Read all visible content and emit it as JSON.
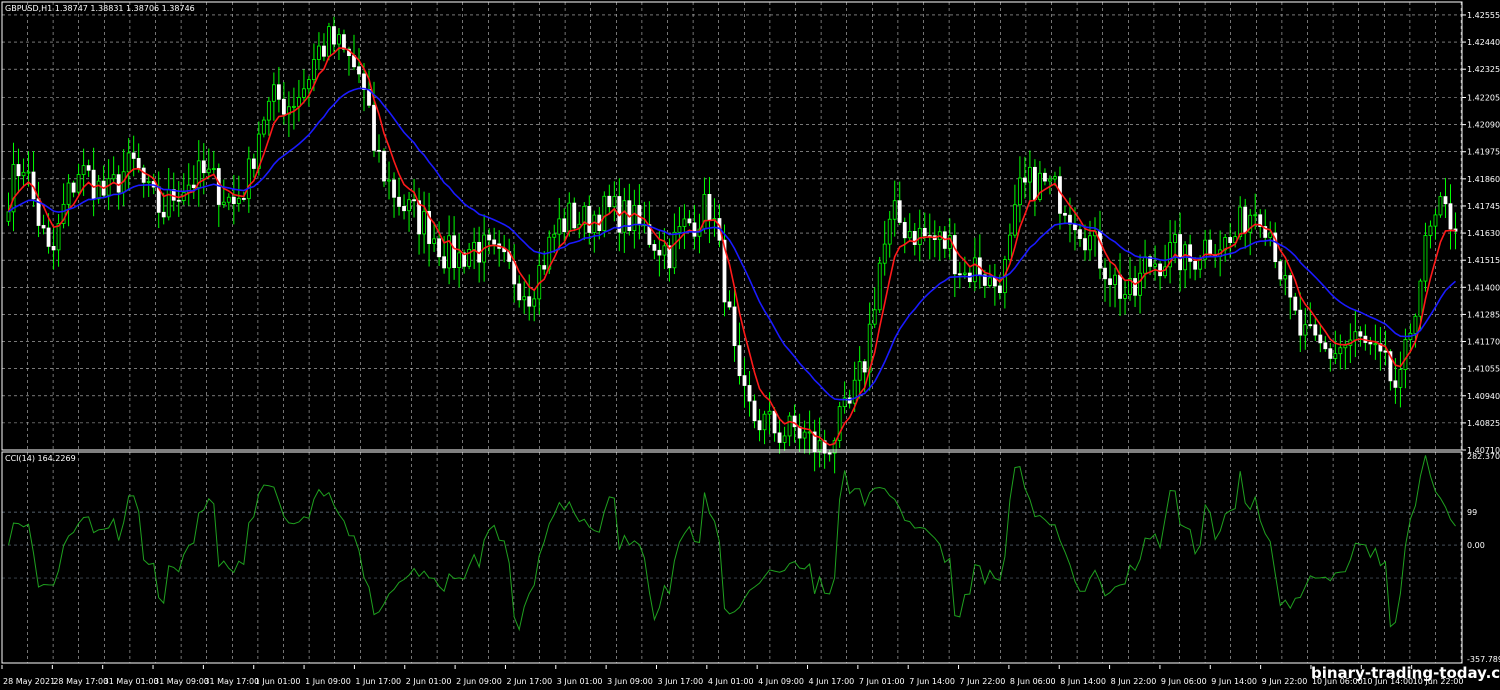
{
  "chart_data": {
    "type": "candlestick",
    "symbol_header": "GBPUSD,H1  1.38747 1.38831 1.38706 1.38746",
    "price_axis_ticks": [
      "1.42555",
      "1.42440",
      "1.42325",
      "1.42205",
      "1.42090",
      "1.41975",
      "1.41860",
      "1.41745",
      "1.41630",
      "1.41515",
      "1.41400",
      "1.41285",
      "1.41170",
      "1.41055",
      "1.40940",
      "1.40825",
      "1.40710"
    ],
    "time_axis_ticks": [
      "28 May 2021",
      "28 May 17:00",
      "31 May 01:00",
      "31 May 09:00",
      "31 May 17:00",
      "1 Jun 01:00",
      "1 Jun 09:00",
      "1 Jun 17:00",
      "2 Jun 01:00",
      "2 Jun 09:00",
      "2 Jun 17:00",
      "3 Jun 01:00",
      "3 Jun 09:00",
      "3 Jun 17:00",
      "4 Jun 01:00",
      "4 Jun 09:00",
      "4 Jun 17:00",
      "7 Jun 01:00",
      "7 Jun 14:00",
      "7 Jun 22:00",
      "8 Jun 06:00",
      "8 Jun 14:00",
      "8 Jun 22:00",
      "9 Jun 06:00",
      "9 Jun 14:00",
      "9 Jun 22:00",
      "10 Jun 06:00",
      "10 Jun 14:00",
      "10 Jun 22:00"
    ],
    "price_range": [
      1.4071,
      1.4261
    ],
    "price_path": [
      1.418,
      1.4195,
      1.4172,
      1.415,
      1.4175,
      1.419,
      1.4185,
      1.4178,
      1.4188,
      1.4192,
      1.4178,
      1.4172,
      1.4182,
      1.4185,
      1.4188,
      1.4182,
      1.4175,
      1.4185,
      1.4212,
      1.422,
      1.4218,
      1.4225,
      1.424,
      1.4245,
      1.4238,
      1.423,
      1.42,
      1.4185,
      1.4175,
      1.417,
      1.4165,
      1.4155,
      1.4152,
      1.4158,
      1.4155,
      1.415,
      1.4145,
      1.4138,
      1.415,
      1.4165,
      1.417,
      1.4168,
      1.4172,
      1.4172,
      1.417,
      1.4165,
      1.416,
      1.4155,
      1.4165,
      1.417,
      1.4175,
      1.414,
      1.4095,
      1.4085,
      1.4082,
      1.4078,
      1.408,
      1.4075,
      1.407,
      1.408,
      1.409,
      1.411,
      1.415,
      1.417,
      1.4165,
      1.4162,
      1.416,
      1.4158,
      1.4145,
      1.415,
      1.414,
      1.4148,
      1.418,
      1.4185,
      1.4183,
      1.4178,
      1.417,
      1.416,
      1.415,
      1.414,
      1.4135,
      1.415,
      1.4152,
      1.4155,
      1.415,
      1.4158,
      1.416,
      1.4158,
      1.417,
      1.4175,
      1.4162,
      1.4135,
      1.412,
      1.4115,
      1.4112,
      1.4115,
      1.4118,
      1.4112,
      1.4105,
      1.4095,
      1.413,
      1.416,
      1.4172,
      1.4168
    ],
    "series": [
      {
        "name": "",
        "color": "#ff1a1a",
        "period": 6
      },
      {
        "name": "",
        "color": "#1a1aff",
        "period": 24
      }
    ],
    "indicator": {
      "title": "CCI(14) 164.2269",
      "axis_ticks": [
        "282.3703",
        "99",
        "0.00",
        "-357.7896"
      ],
      "range": [
        -357.7896,
        282.3703
      ],
      "level": 100
    },
    "grid": true
  },
  "watermark": "binary-trading-today.com",
  "colors": {
    "bull": "#00ff00",
    "bear": "#ffffff",
    "grid": "#c0c0c0",
    "cci": "#1fa01f",
    "level": "#708090"
  }
}
